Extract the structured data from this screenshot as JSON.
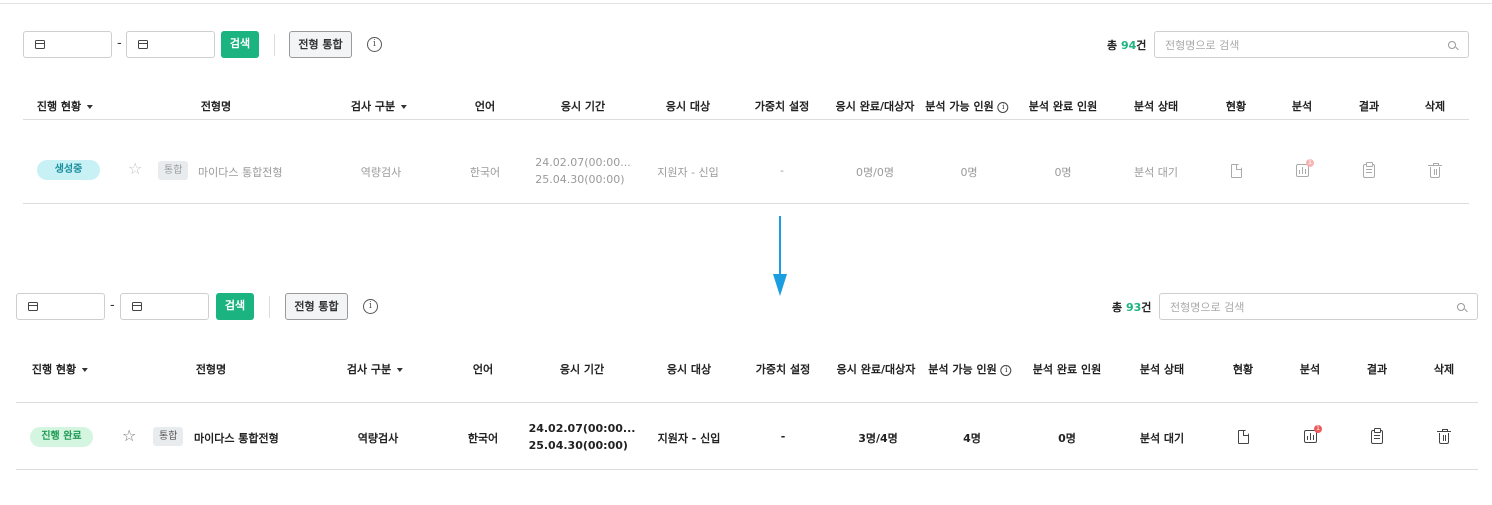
{
  "colors": {
    "accent": "#1bb37f",
    "arrow": "#1a9ee0",
    "badge_creating_bg": "#c8f1f5",
    "badge_creating_fg": "#1a8e9c",
    "badge_done_bg": "#d4f5df",
    "badge_done_fg": "#1f9a55",
    "notice_dot": "#f05a5a"
  },
  "toolbar": {
    "date_separator": "-",
    "search_label": "검색",
    "merge_label": "전형 통합",
    "info_glyph": "i",
    "search_placeholder": "전형명으로 검색"
  },
  "columns": {
    "status": "진행 현황",
    "name": "전형명",
    "test_type": "검사 구분",
    "language": "언어",
    "period": "응시 기간",
    "target": "응시 대상",
    "weight": "가중치 설정",
    "completed": "응시 완료/대상자",
    "analyzable": "분석 가능 인원",
    "analyzed": "분석 완료 인원",
    "analysis_status": "분석 상태",
    "overview": "현황",
    "analysis": "분석",
    "result": "결과",
    "delete": "삭제",
    "info_glyph": "i"
  },
  "before": {
    "count_prefix": "총 ",
    "count": "94",
    "count_suffix": "건",
    "row": {
      "status_badge": "생성중",
      "star_glyph": "☆",
      "tag": "통합",
      "name": "마이다스 통합전형",
      "test_type": "역량검사",
      "language": "한국어",
      "period_start": "24.02.07(00:00...",
      "period_end": "25.04.30(00:00)",
      "target": "지원자 - 신입",
      "weight": "-",
      "completed": "0명/0명",
      "analyzable": "0명",
      "analyzed": "0명",
      "analysis_status": "분석 대기",
      "notice_count": "1"
    }
  },
  "after": {
    "count_prefix": "총 ",
    "count": "93",
    "count_suffix": "건",
    "row": {
      "status_badge": "진행 완료",
      "star_glyph": "☆",
      "tag": "통합",
      "name": "마이다스 통합전형",
      "test_type": "역량검사",
      "language": "한국어",
      "period_start": "24.02.07(00:00...",
      "period_end": "25.04.30(00:00)",
      "target": "지원자 - 신입",
      "weight": "-",
      "completed": "3명/4명",
      "analyzable": "4명",
      "analyzed": "0명",
      "analysis_status": "분석 대기",
      "notice_count": "1"
    }
  }
}
